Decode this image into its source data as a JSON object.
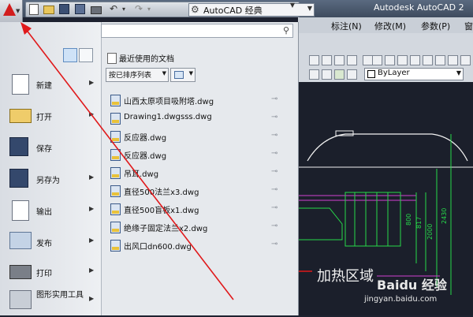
{
  "titlebar": {
    "workspace": "AutoCAD 经典",
    "app_title": "Autodesk AutoCAD 2"
  },
  "menubar": {
    "items": [
      "标注(N)",
      "修改(M)",
      "参数(P)",
      "窗"
    ]
  },
  "properties": {
    "layer_value": "ByLayer"
  },
  "app_menu": {
    "left_items": [
      {
        "label": "新建",
        "icon": "new-doc-icon",
        "has_submenu": true
      },
      {
        "label": "打开",
        "icon": "open-folder-icon",
        "has_submenu": true
      },
      {
        "label": "保存",
        "icon": "save-disk-icon",
        "has_submenu": false
      },
      {
        "label": "另存为",
        "icon": "save-as-icon",
        "has_submenu": true
      },
      {
        "label": "输出",
        "icon": "export-icon",
        "has_submenu": true
      },
      {
        "label": "发布",
        "icon": "publish-icon",
        "has_submenu": true
      },
      {
        "label": "打印",
        "icon": "print-icon",
        "has_submenu": true
      },
      {
        "label": "图形实用工具",
        "icon": "utilities-icon",
        "has_submenu": true
      }
    ],
    "recent": {
      "title": "最近使用的文档",
      "sort_by": "按已排序列表",
      "files": [
        "山西太原项目吸附塔.dwg",
        "Drawing1.dwgsss.dwg",
        "反应器.dwg",
        "反应器.dwg",
        "吊耳.dwg",
        "直径500法兰x3.dwg",
        "直径500盲板x1.dwg",
        "绝缘子固定法兰x2.dwg",
        "出风口dn600.dwg"
      ]
    }
  },
  "drawing": {
    "zone_label": "加热区域",
    "dimensions": [
      "800",
      "817",
      "2000",
      "2430"
    ]
  },
  "watermark": {
    "name": "Baidu 经验",
    "url": "jingyan.baidu.com"
  },
  "colors": {
    "annotation_arrow": "#e0191b",
    "canvas_bg": "#1b1f2b",
    "drawing_white": "#f2f2f2",
    "dimension_green": "#27d94a",
    "hatch_magenta": "#d040d0"
  }
}
